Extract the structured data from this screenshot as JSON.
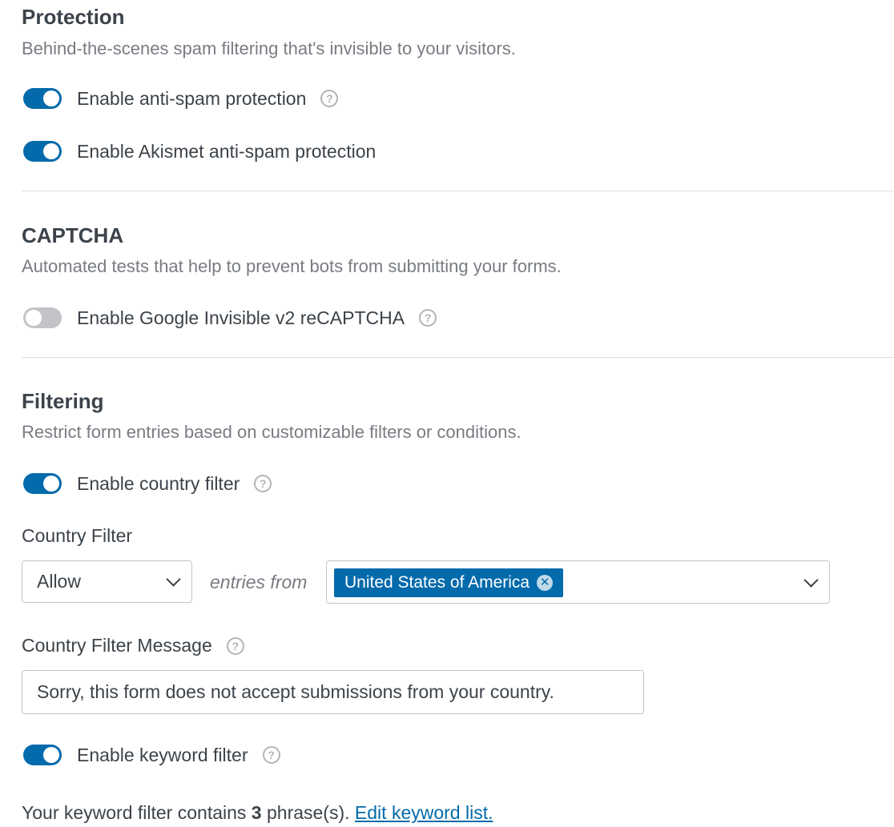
{
  "protection": {
    "title": "Protection",
    "description": "Behind-the-scenes spam filtering that's invisible to your visitors.",
    "antispam": {
      "label": "Enable anti-spam protection",
      "enabled": true,
      "help_icon": "question-circle-icon"
    },
    "akismet": {
      "label": "Enable Akismet anti-spam protection",
      "enabled": true
    }
  },
  "captcha": {
    "title": "CAPTCHA",
    "description": "Automated tests that help to prevent bots from submitting your forms.",
    "recaptcha": {
      "label": "Enable Google Invisible v2 reCAPTCHA",
      "enabled": false,
      "help_icon": "question-circle-icon"
    }
  },
  "filtering": {
    "title": "Filtering",
    "description": "Restrict form entries based on customizable filters or conditions.",
    "country_toggle": {
      "label": "Enable country filter",
      "enabled": true,
      "help_icon": "question-circle-icon"
    },
    "country_filter": {
      "label": "Country Filter",
      "action_value": "Allow",
      "connector": "entries from",
      "selected_countries": [
        "United States of America"
      ]
    },
    "country_message": {
      "label": "Country Filter Message",
      "value": "Sorry, this form does not accept submissions from your country."
    },
    "keyword_toggle": {
      "label": "Enable keyword filter",
      "enabled": true,
      "help_icon": "question-circle-icon"
    },
    "keyword_summary": {
      "prefix": "Your keyword filter contains",
      "count": "3",
      "suffix": "phrase(s).",
      "link": "Edit keyword list."
    }
  },
  "colors": {
    "accent": "#036aab",
    "toggle_off": "#c3c4c7",
    "text": "#3c434a",
    "muted": "#787c82"
  }
}
